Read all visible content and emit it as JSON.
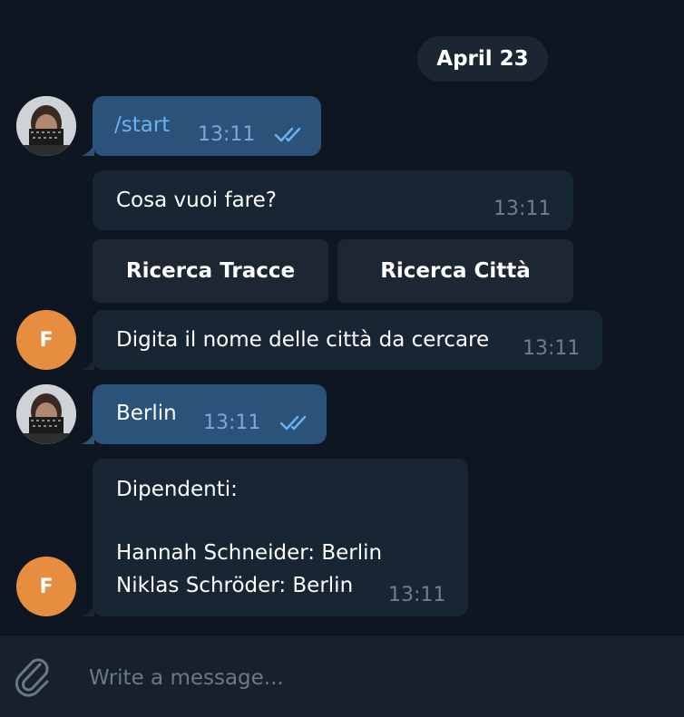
{
  "date_separator": "April 23",
  "messages": [
    {
      "id": "m1",
      "text": "/start",
      "time": "13:11",
      "read": true
    },
    {
      "id": "m2",
      "text": "Cosa vuoi fare?",
      "time": "13:11"
    },
    {
      "id": "m3",
      "text": "Digita il nome delle città da cercare",
      "time": "13:11",
      "avatar_letter": "F"
    },
    {
      "id": "m4",
      "text": "Berlin",
      "time": "13:11",
      "read": true
    },
    {
      "id": "m5",
      "lines": [
        "Dipendenti:",
        "",
        "Hannah Schneider: Berlin",
        "Niklas Schröder: Berlin"
      ],
      "time": "13:11",
      "avatar_letter": "F"
    }
  ],
  "keyboard": {
    "buttons": [
      "Ricerca Tracce",
      "Ricerca Città"
    ]
  },
  "composer": {
    "placeholder": "Write a message..."
  },
  "colors": {
    "background": "#0e1621",
    "outgoing_bubble": "#2b5278",
    "incoming_bubble": "#182533",
    "bot_avatar": "#e78d40",
    "read_ticks": "#6ab3f3"
  },
  "icons": {
    "attach": "paperclip-icon",
    "read_status": "double-check-icon"
  }
}
